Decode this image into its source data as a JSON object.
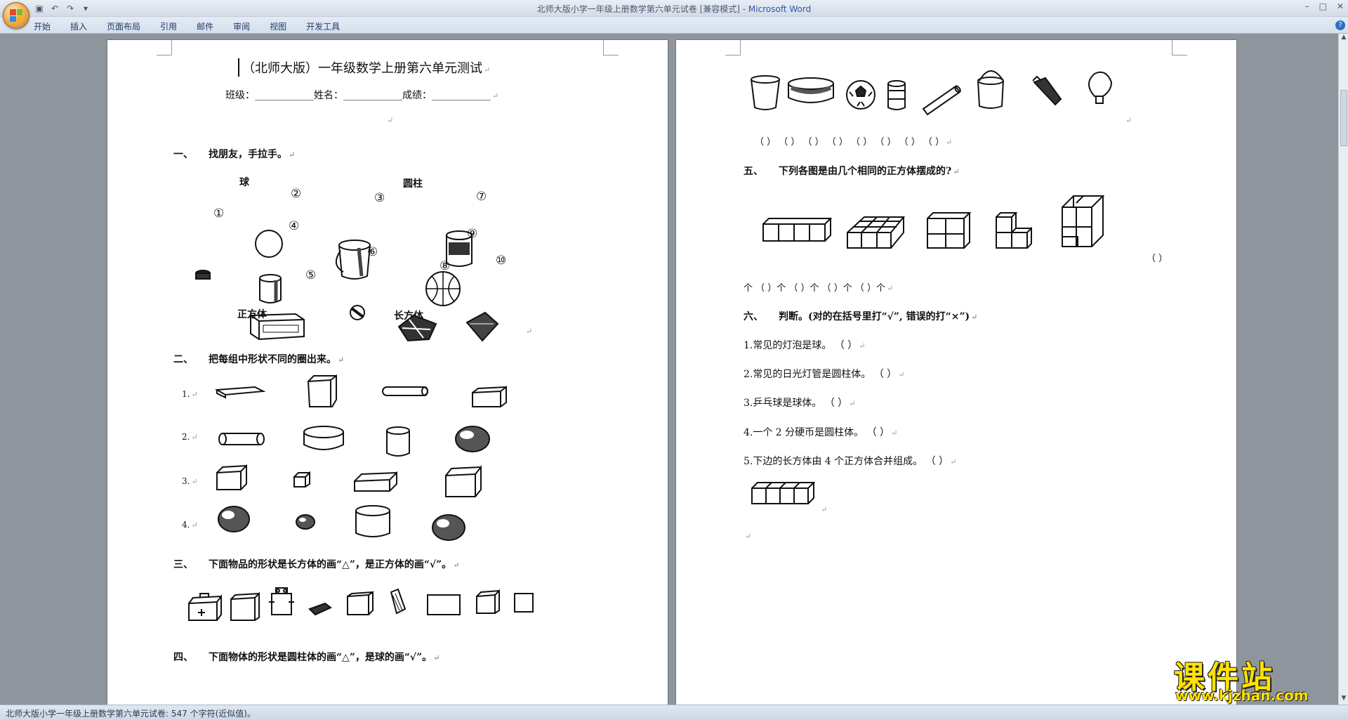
{
  "window": {
    "title": "北师大版小学一年级上册数学第六单元试卷 [兼容模式] - ",
    "app_name": "Microsoft Word"
  },
  "ribbon": {
    "tabs": [
      "开始",
      "插入",
      "页面布局",
      "引用",
      "邮件",
      "审阅",
      "视图",
      "开发工具"
    ]
  },
  "doc_left": {
    "title": "（北师大版）一年级数学上册第六单元测试",
    "info_line": "班级：____________姓名：____________成绩：____________",
    "s1": {
      "num": "一、",
      "title": "找朋友，手拉手。"
    },
    "s1_labels": {
      "ball": "球",
      "cylinder": "圆柱",
      "cube": "正方体",
      "cuboid": "长方体"
    },
    "s1_numbers": [
      "①",
      "②",
      "③",
      "④",
      "⑤",
      "⑥",
      "⑦",
      "⑧",
      "⑨",
      "⑩"
    ],
    "s2": {
      "num": "二、",
      "title": "把每组中形状不同的圈出来。"
    },
    "s2_rows": [
      "1.",
      "2.",
      "3.",
      "4."
    ],
    "s3": {
      "num": "三、",
      "title": "下面物品的形状是长方体的画“△”，是正方体的画“√”。"
    },
    "s4": {
      "num": "四、",
      "title": "下面物体的形状是圆柱体的画“△”，是球的画“√”。"
    }
  },
  "doc_right": {
    "s4_answers": "（ ）      （ ）      （ ）  （ ）    （ ）      （ ）      （ ）      （ ）",
    "s5": {
      "num": "五、",
      "title": "下列各图是由几个相同的正方体摆成的?"
    },
    "s5_last_blank": "（ ）",
    "s5_answers": "个              （    ）个       （    ）个       （    ）个       （    ）个",
    "s6": {
      "num": "六、",
      "title": "判断。(对的在括号里打“√”, 错误的打“×”)"
    },
    "s6_items": [
      "1.常见的灯泡是球。  （    ）",
      "2.常见的日光灯管是圆柱体。     （    ）",
      "3.乒乓球是球体。    （    ）",
      "4.一个 2 分硬币是圆柱体。     （    ）",
      "5.下边的长方体由 4 个正方体合并组成。     （    ）"
    ]
  },
  "status": {
    "text": "北师大版小学一年级上册数学第六单元试卷: 547 个字符(近似值)。"
  },
  "watermark": {
    "brand": "课件站",
    "url": "www.kjzhan.com"
  },
  "colors": {
    "titlebar": "#dbe3ef",
    "page": "#ffffff",
    "workspace": "#8f959c",
    "watermark": "#ffe300"
  }
}
